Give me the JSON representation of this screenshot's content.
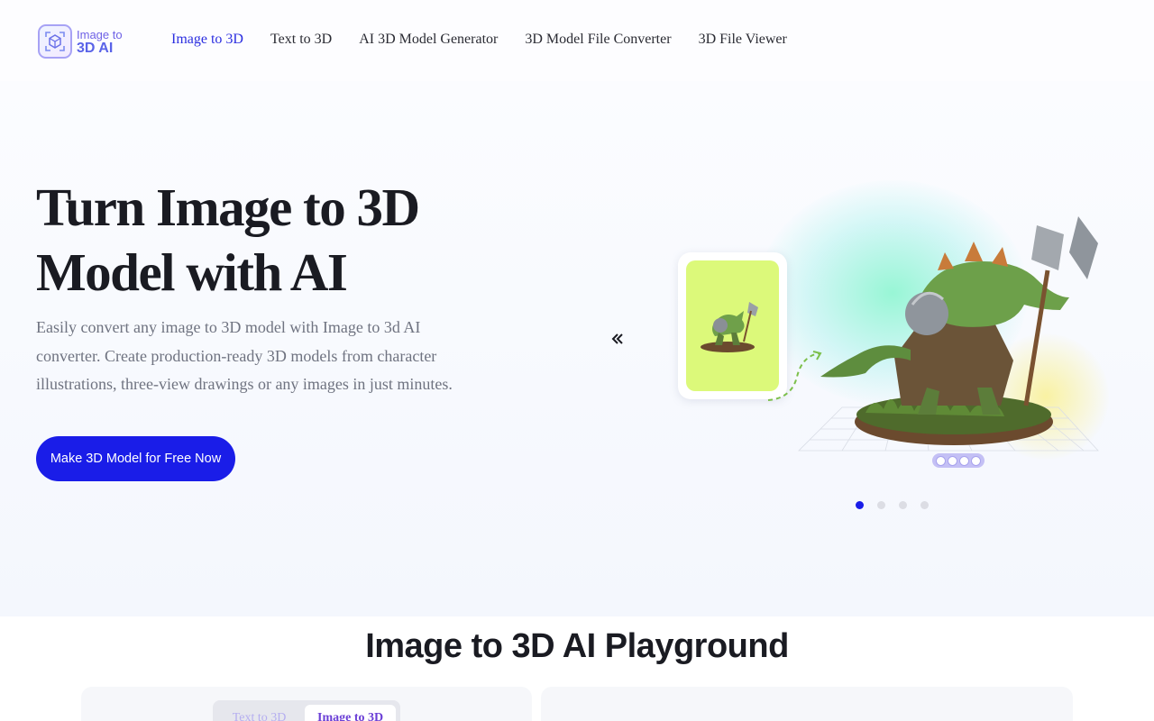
{
  "header": {
    "logo": {
      "line1": "Image to",
      "line2": "3D AI"
    },
    "nav": [
      {
        "label": "Image to 3D",
        "active": true
      },
      {
        "label": "Text to 3D",
        "active": false
      },
      {
        "label": "AI 3D Model Generator",
        "active": false
      },
      {
        "label": "3D Model File Converter",
        "active": false
      },
      {
        "label": "3D File Viewer",
        "active": false
      }
    ]
  },
  "hero": {
    "title": "Turn Image to 3D Model with AI",
    "description": "Easily convert any image to 3D model with Image to 3d AI converter. Create production-ready 3D models from character illustrations, three-view drawings or any images in just minutes.",
    "cta_label": "Make 3D Model for Free Now",
    "carousel": {
      "slide_count": 4,
      "active_index": 0,
      "prev_icon": "double-chevron-left-icon"
    }
  },
  "playground": {
    "title": "Image to 3D AI Playground",
    "tabs": [
      {
        "label": "Text to 3D",
        "active": false
      },
      {
        "label": "Image to 3D",
        "active": true
      }
    ]
  },
  "colors": {
    "accent": "#1a1de8",
    "nav_active": "#2b2ee0",
    "input_card_bg": "#dcf97a"
  }
}
